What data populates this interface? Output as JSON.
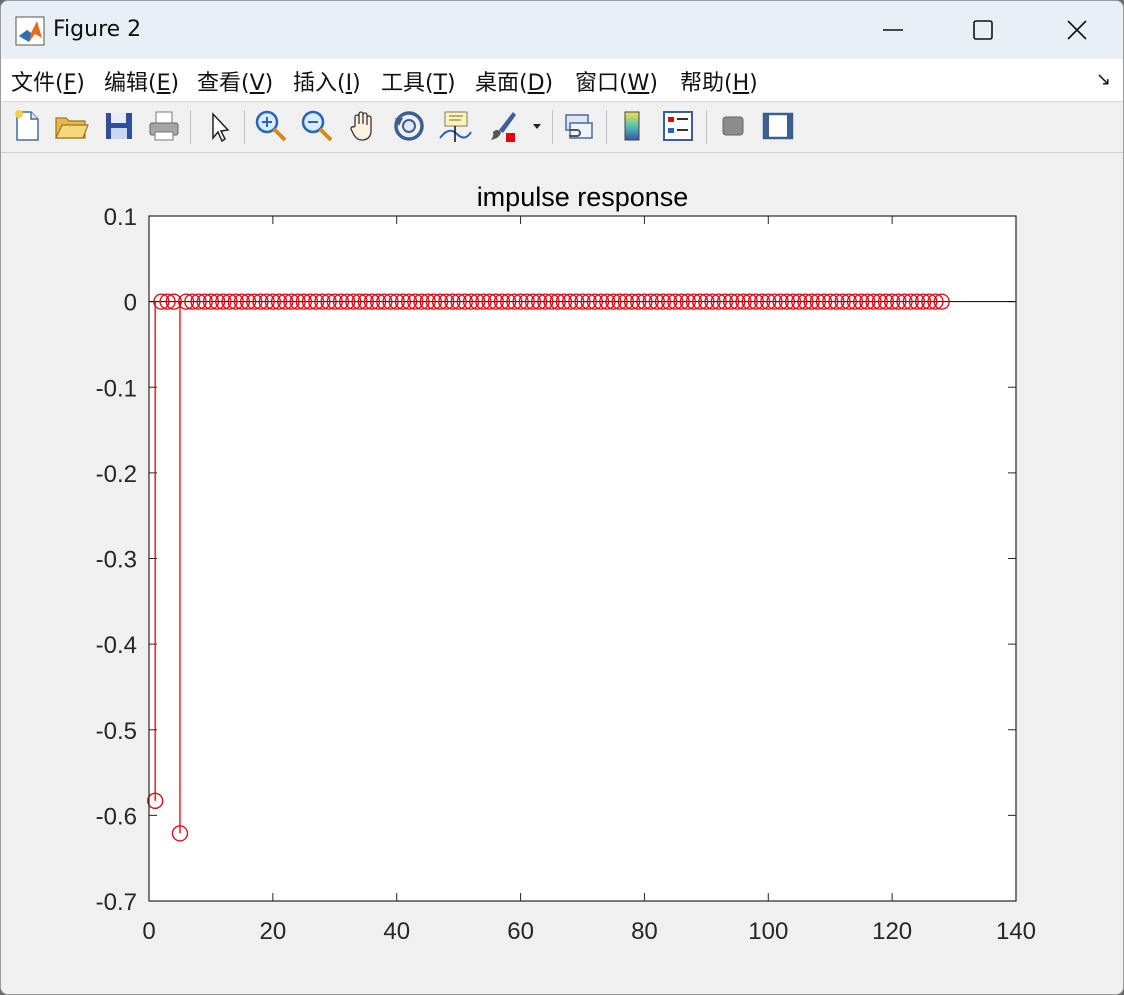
{
  "window": {
    "title": "Figure 2",
    "controls": [
      "minimize-icon",
      "maximize-icon",
      "close-icon"
    ]
  },
  "menu": {
    "items": [
      {
        "label_pre": "文件(",
        "accel": "F",
        "label_post": ")"
      },
      {
        "label_pre": "编辑(",
        "accel": "E",
        "label_post": ")"
      },
      {
        "label_pre": "查看(",
        "accel": "V",
        "label_post": ")"
      },
      {
        "label_pre": "插入(",
        "accel": "I",
        "label_post": ")"
      },
      {
        "label_pre": "工具(",
        "accel": "T",
        "label_post": ")"
      },
      {
        "label_pre": "桌面(",
        "accel": "D",
        "label_post": ")"
      },
      {
        "label_pre": "窗口(",
        "accel": "W",
        "label_post": ")"
      },
      {
        "label_pre": "帮助(",
        "accel": "H",
        "label_post": ")"
      }
    ],
    "dock_arrow": "↘"
  },
  "toolbar": {
    "buttons": [
      "new-figure-icon",
      "open-file-icon",
      "save-icon",
      "print-icon",
      "edit-plot-arrow-icon",
      "zoom-in-icon",
      "zoom-out-icon",
      "pan-hand-icon",
      "rotate-3d-icon",
      "data-cursor-icon",
      "brush-icon",
      "link-plot-icon",
      "colorbar-icon",
      "legend-icon",
      "hide-plot-tools-icon",
      "show-plot-tools-icon"
    ]
  },
  "colors": {
    "stem": "#e8000b",
    "baseline": "#000000",
    "axes": "#262626"
  },
  "chart_data": {
    "type": "stem",
    "title": "impulse response",
    "xlabel": "",
    "ylabel": "",
    "xlim": [
      0,
      140
    ],
    "ylim": [
      -0.7,
      0.1
    ],
    "xticks": [
      "0",
      "20",
      "40",
      "60",
      "80",
      "100",
      "120",
      "140"
    ],
    "yticks": [
      "0.1",
      "0",
      "-0.1",
      "-0.2",
      "-0.3",
      "-0.4",
      "-0.5",
      "-0.6",
      "-0.7"
    ],
    "n_start": 1,
    "n_end": 128,
    "nonzero": [
      {
        "n": 1,
        "value": -0.583
      },
      {
        "n": 5,
        "value": -0.621
      }
    ],
    "default_value": 0
  }
}
